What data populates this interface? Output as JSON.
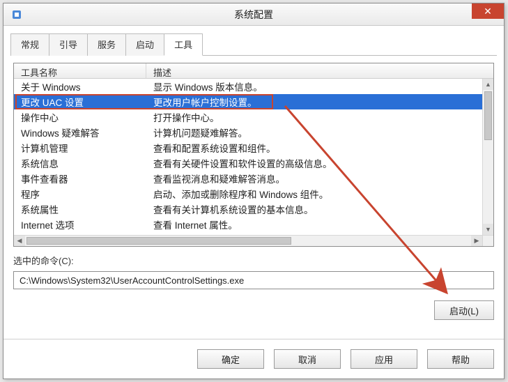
{
  "window": {
    "title": "系统配置",
    "close_symbol": "✕"
  },
  "tabs": [
    {
      "label": "常规"
    },
    {
      "label": "引导"
    },
    {
      "label": "服务"
    },
    {
      "label": "启动"
    },
    {
      "label": "工具",
      "active": true
    }
  ],
  "columns": {
    "name": "工具名称",
    "desc": "描述"
  },
  "rows": [
    {
      "name": "关于 Windows",
      "desc": "显示 Windows 版本信息。"
    },
    {
      "name": "更改 UAC 设置",
      "desc": "更改用户帐户控制设置。",
      "selected": true
    },
    {
      "name": "操作中心",
      "desc": "打开操作中心。"
    },
    {
      "name": "Windows 疑难解答",
      "desc": "计算机问题疑难解答。"
    },
    {
      "name": "计算机管理",
      "desc": "查看和配置系统设置和组件。"
    },
    {
      "name": "系统信息",
      "desc": "查看有关硬件设置和软件设置的高级信息。"
    },
    {
      "name": "事件查看器",
      "desc": "查看监视消息和疑难解答消息。"
    },
    {
      "name": "程序",
      "desc": "启动、添加或删除程序和 Windows 组件。"
    },
    {
      "name": "系统属性",
      "desc": "查看有关计算机系统设置的基本信息。"
    },
    {
      "name": "Internet 选项",
      "desc": "查看 Internet 属性。"
    }
  ],
  "selected_command": {
    "label": "选中的命令(C):",
    "value": "C:\\Windows\\System32\\UserAccountControlSettings.exe"
  },
  "buttons": {
    "launch": "启动(L)",
    "ok": "确定",
    "cancel": "取消",
    "apply": "应用",
    "help": "帮助"
  },
  "scroll": {
    "up": "▲",
    "down": "▼",
    "left": "◀",
    "right": "▶"
  },
  "colors": {
    "selection": "#2a6fd6",
    "annotation": "#c8442f"
  }
}
